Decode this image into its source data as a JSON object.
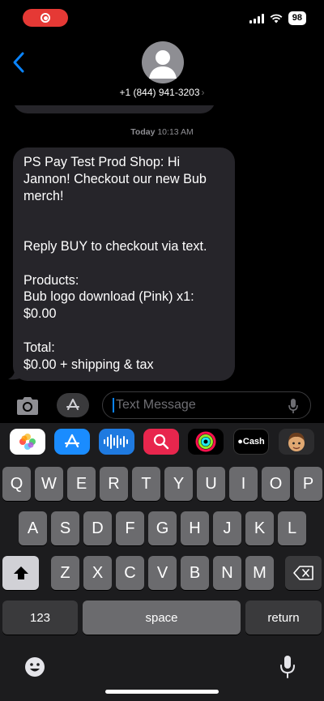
{
  "status_bar": {
    "battery": "98"
  },
  "header": {
    "contact": "+1 (844) 941-3203",
    "chevron": "›"
  },
  "thread": {
    "timestamp_day": "Today",
    "timestamp_time": "10:13 AM",
    "message": "PS Pay Test Prod Shop: Hi Jannon! Checkout our new Bub merch!\n\n\nReply BUY to checkout via text.\n\nProducts:\nBub logo download (Pink) x1:\n$0.00\n\nTotal:\n$0.00 + shipping & tax"
  },
  "compose": {
    "placeholder": "Text Message"
  },
  "app_drawer": {
    "items": [
      "photos-app-icon",
      "app-store-icon",
      "audio-message-icon",
      "search-images-icon",
      "activity-icon",
      "apple-cash-icon",
      "memoji-icon"
    ],
    "apple_cash_label": "Cash"
  },
  "keyboard": {
    "row1": [
      "Q",
      "W",
      "E",
      "R",
      "T",
      "Y",
      "U",
      "I",
      "O",
      "P"
    ],
    "row2": [
      "A",
      "S",
      "D",
      "F",
      "G",
      "H",
      "J",
      "K",
      "L"
    ],
    "row3": [
      "Z",
      "X",
      "C",
      "V",
      "B",
      "N",
      "M"
    ],
    "numbers_label": "123",
    "space_label": "space",
    "return_label": "return"
  },
  "colors": {
    "accent": "#0a84ff",
    "bubble": "#26252a",
    "record": "#e53935"
  }
}
